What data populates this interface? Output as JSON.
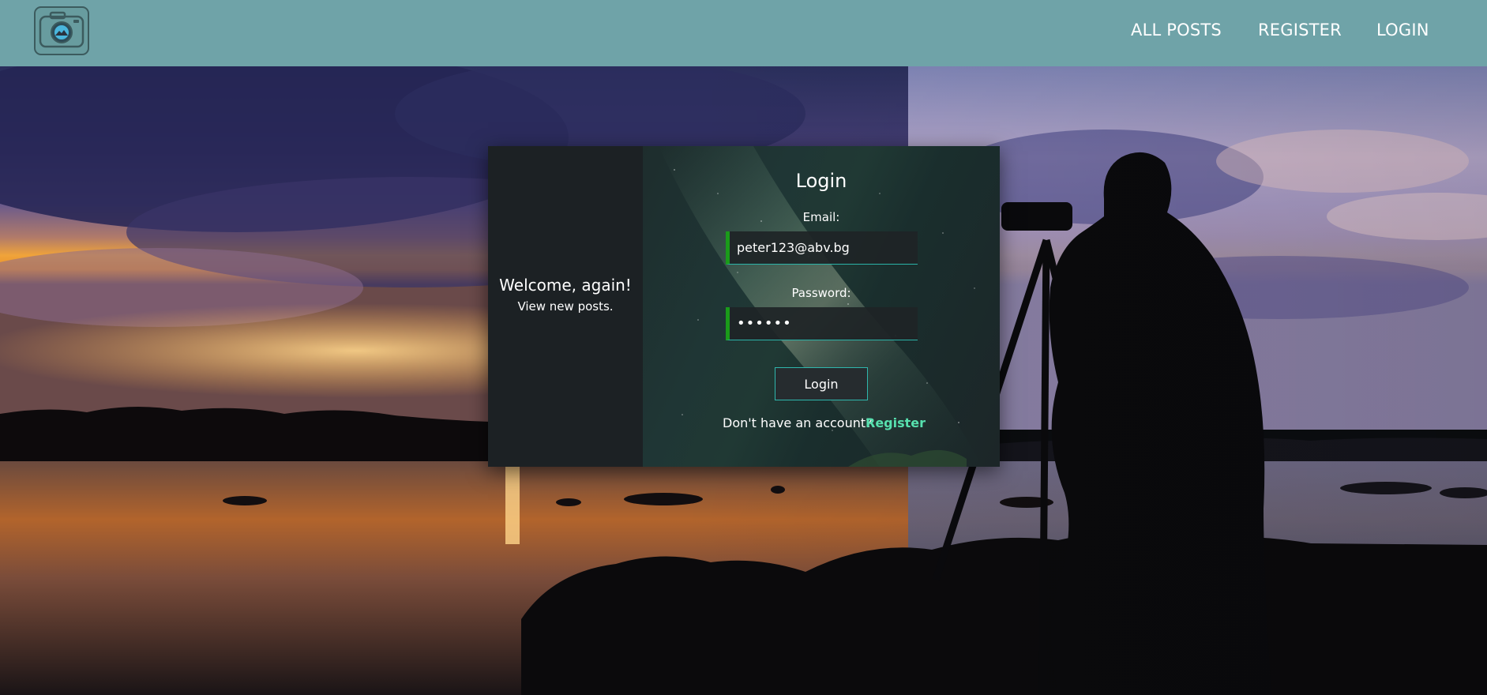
{
  "header": {
    "logo_icon": "camera-icon",
    "nav": {
      "all_posts": "ALL POSTS",
      "register": "REGISTER",
      "login": "LOGIN"
    }
  },
  "card": {
    "welcome_title": "Welcome, again!",
    "welcome_subtitle": "View new posts.",
    "form_title": "Login",
    "email_label": "Email:",
    "email_value": "peter123@abv.bg",
    "password_label": "Password:",
    "password_value": "••••••",
    "login_button": "Login",
    "no_account_text": "Don't have an account?",
    "register_link": "Register"
  },
  "colors": {
    "header_bg": "#6fa3a8",
    "accent_teal": "#2fb7ad",
    "input_accent_green": "#1a9b1a",
    "register_link": "#57e0ae"
  }
}
